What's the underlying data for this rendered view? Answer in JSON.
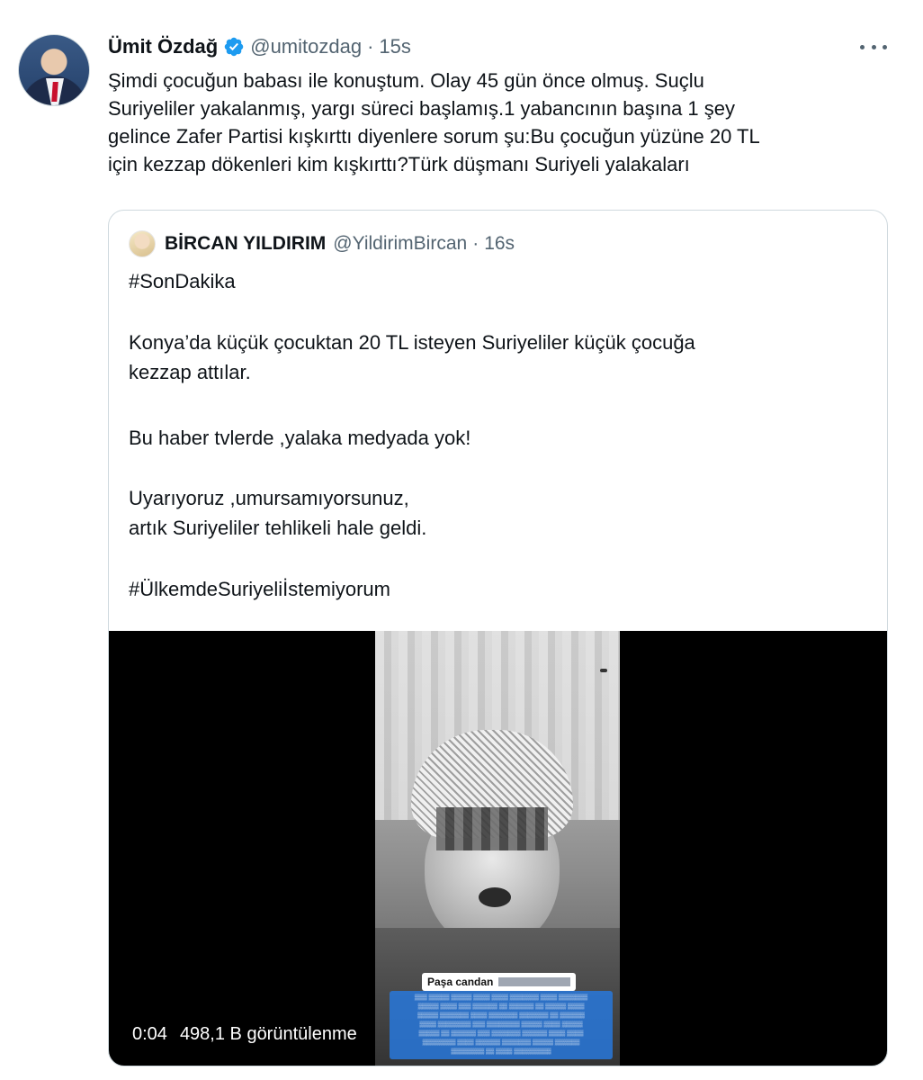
{
  "tweet": {
    "author_name": "Ümit Özdağ",
    "handle": "@umitozdag",
    "separator": "·",
    "time": "15s",
    "text": "Şimdi çocuğun babası ile konuştum. Olay 45 gün önce olmuş. Suçlu\nSuriyeliler yakalanmış, yargı süreci başlamış.1 yabancının başına 1 şey\ngelince Zafer Partisi kışkırttı diyenlere sorum şu:Bu çocuğun yüzüne 20 TL\niçin kezzap dökenleri kim kışkırttı?Türk düşmanı Suriyeli yalakaları",
    "verified_color": "#1d9bf0",
    "icons": {
      "verified": "verified-badge-icon",
      "more": "more-options-icon"
    }
  },
  "quoted": {
    "author_name": "BİRCAN YILDIRIM",
    "handle": "@YildirimBircan",
    "separator": "·",
    "time": "16s",
    "hashtag1": "#SonDakika",
    "paragraph1": "Konya’da küçük çocuktan 20 TL isteyen Suriyeliler küçük çocuğa\nkezzap attılar.",
    "paragraph2": "Bu haber tvlerde ,yalaka medyada yok!",
    "paragraph3": "Uyarıyoruz ,umursamıyorsunuz,\nartık Suriyeliler tehlikeli hale geldi.",
    "hashtag2": "#ÜlkemdeSuriyeliİstemiyorum",
    "video": {
      "duration": "0:04",
      "views": "498,1 B görüntülenme",
      "overlay_title": "Paşa candan"
    }
  }
}
